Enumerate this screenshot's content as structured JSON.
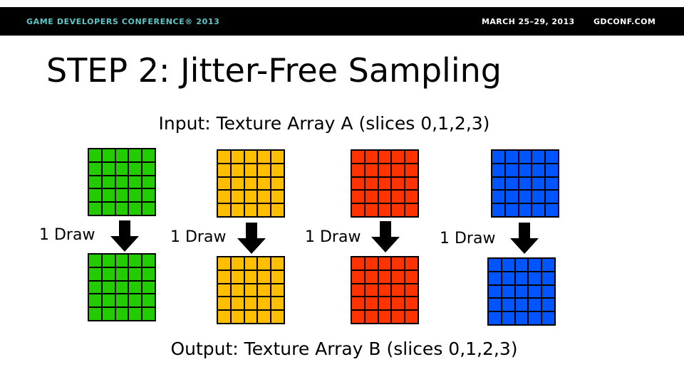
{
  "header": {
    "conference": "GAME DEVELOPERS CONFERENCE® 2013",
    "dates": "MARCH 25–29, 2013",
    "site": "GDCONF.COM"
  },
  "slide": {
    "title": "STEP 2: Jitter-Free Sampling",
    "input_caption": "Input: Texture Array A (slices 0,1,2,3)",
    "output_caption": "Output: Texture Array B (slices 0,1,2,3)",
    "slices": [
      {
        "color": "#22cc00",
        "draw_label": "1 Draw"
      },
      {
        "color": "#ffbf00",
        "draw_label": "1 Draw"
      },
      {
        "color": "#ff3300",
        "draw_label": "1 Draw"
      },
      {
        "color": "#0055ff",
        "draw_label": "1 Draw"
      }
    ],
    "grid_size": 5
  },
  "colors": {
    "header_bg": "#000000",
    "header_accent": "#5ec8c8"
  }
}
